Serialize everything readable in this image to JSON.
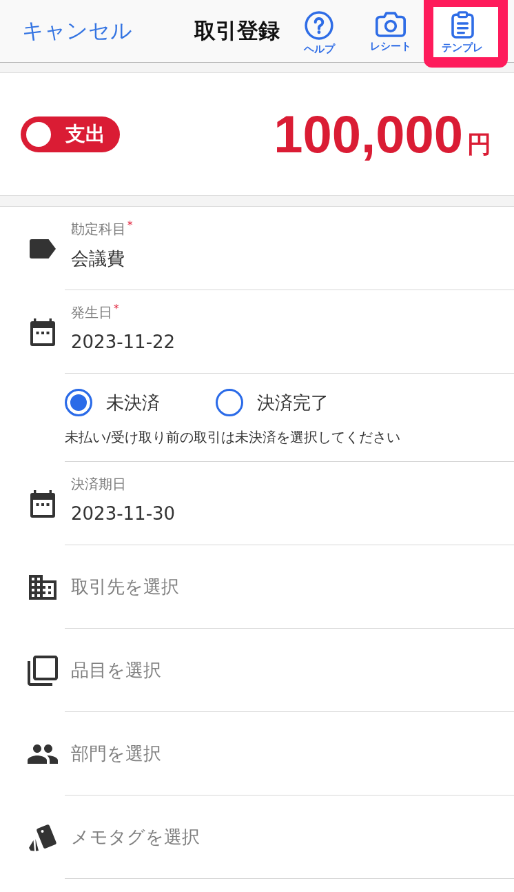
{
  "header": {
    "cancel": "キャンセル",
    "title": "取引登録",
    "actions": [
      {
        "label": "ヘルプ",
        "highlighted": false
      },
      {
        "label": "レシート",
        "highlighted": false
      },
      {
        "label": "テンプレ",
        "highlighted": true
      }
    ]
  },
  "entry_type": {
    "label": "支出",
    "on": false
  },
  "amount": {
    "value": "100,000",
    "unit": "円"
  },
  "fields": [
    {
      "kind": "field",
      "label": "勘定科目",
      "required_mark": "*",
      "value": "会議費"
    },
    {
      "kind": "field",
      "label": "発生日",
      "required_mark": "*",
      "value": "2023-11-22"
    },
    {
      "kind": "radio",
      "options": [
        {
          "label": "未決済",
          "selected": true
        },
        {
          "label": "決済完了",
          "selected": false
        }
      ],
      "hint": "未払い/受け取り前の取引は未決済を選択してください"
    },
    {
      "kind": "field",
      "label": "決済期日",
      "value": "2023-11-30"
    },
    {
      "kind": "select",
      "placeholder": "取引先を選択"
    },
    {
      "kind": "select",
      "placeholder": "品目を選択"
    },
    {
      "kind": "select",
      "placeholder": "部門を選択"
    },
    {
      "kind": "select",
      "placeholder": "メモタグを選択"
    }
  ]
}
